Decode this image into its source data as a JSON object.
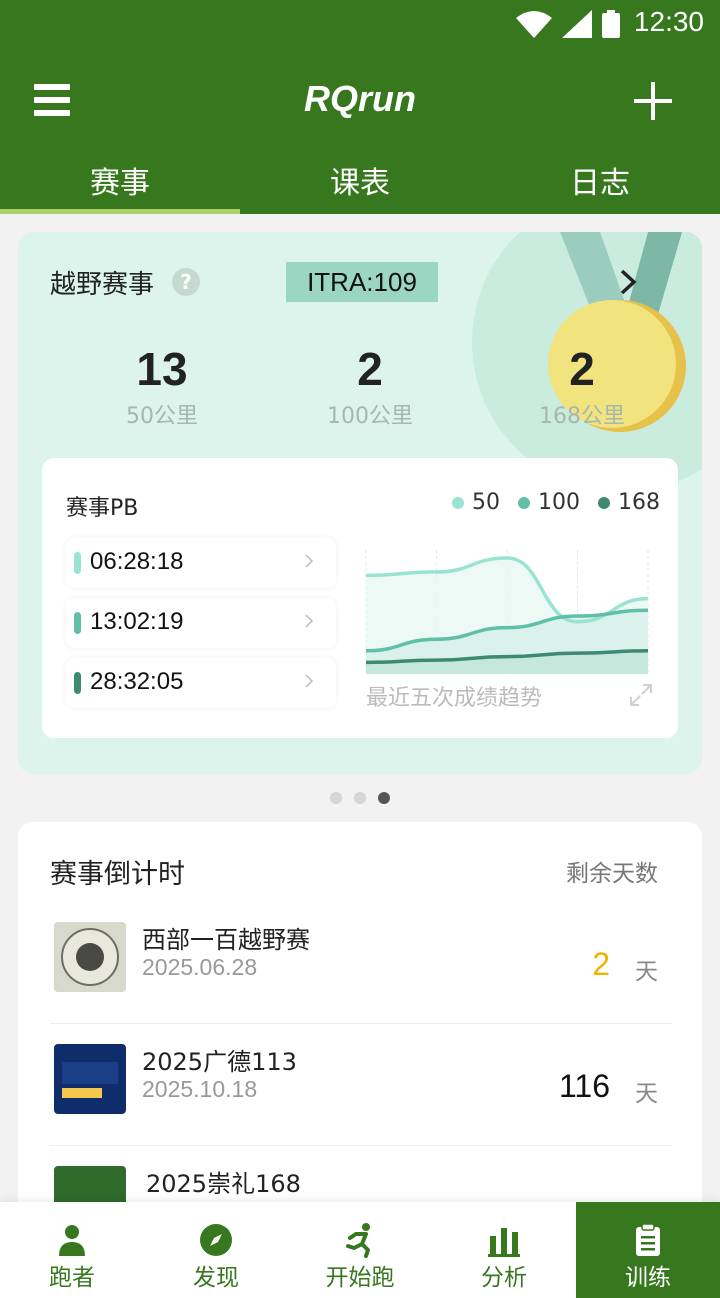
{
  "status_bar": {
    "time": "12:30"
  },
  "app": {
    "title": "RQrun"
  },
  "tabs": [
    {
      "label": "赛事",
      "active": true
    },
    {
      "label": "课表",
      "active": false
    },
    {
      "label": "日志",
      "active": false
    }
  ],
  "trail_card": {
    "title": "越野赛事",
    "itra": "ITRA:109",
    "stats": [
      {
        "count": "13",
        "label": "50公里"
      },
      {
        "count": "2",
        "label": "100公里"
      },
      {
        "count": "2",
        "label": "168公里"
      }
    ],
    "pb": {
      "title": "赛事PB",
      "legend": [
        "50",
        "100",
        "168"
      ],
      "times": [
        "06:28:18",
        "13:02:19",
        "28:32:05"
      ],
      "caption": "最近五次成绩趋势"
    }
  },
  "chart_data": {
    "type": "area",
    "series": [
      {
        "name": "50",
        "values": [
          0.85,
          0.88,
          1.0,
          0.45,
          0.65
        ]
      },
      {
        "name": "100",
        "values": [
          0.2,
          0.3,
          0.4,
          0.5,
          0.55
        ]
      },
      {
        "name": "168",
        "values": [
          0.1,
          0.12,
          0.15,
          0.18,
          0.2
        ]
      }
    ],
    "colors": [
      "#98e3d2",
      "#5fbfa7",
      "#3e8a70"
    ]
  },
  "countdown": {
    "title": "赛事倒计时",
    "subtitle": "剩余天数",
    "races": [
      {
        "name": "西部一百越野赛",
        "date": "2025.06.28",
        "days": "2",
        "unit": "天",
        "highlight": true
      },
      {
        "name": "2025广德113",
        "date": "2025.10.18",
        "days": "116",
        "unit": "天",
        "highlight": false
      },
      {
        "name": "2025崇礼168",
        "date": "",
        "days": "",
        "unit": "",
        "highlight": false
      }
    ]
  },
  "bottom_nav": [
    {
      "label": "跑者",
      "icon": "person-icon"
    },
    {
      "label": "发现",
      "icon": "compass-icon"
    },
    {
      "label": "开始跑",
      "icon": "runner-icon"
    },
    {
      "label": "分析",
      "icon": "bar-chart-icon"
    },
    {
      "label": "训练",
      "icon": "clipboard-icon",
      "active": true
    }
  ],
  "colors": {
    "primary": "#37781f",
    "tab_indicator": "#a9d36a",
    "card_bg": "#dcf4ec",
    "highlight": "#f0b400"
  }
}
